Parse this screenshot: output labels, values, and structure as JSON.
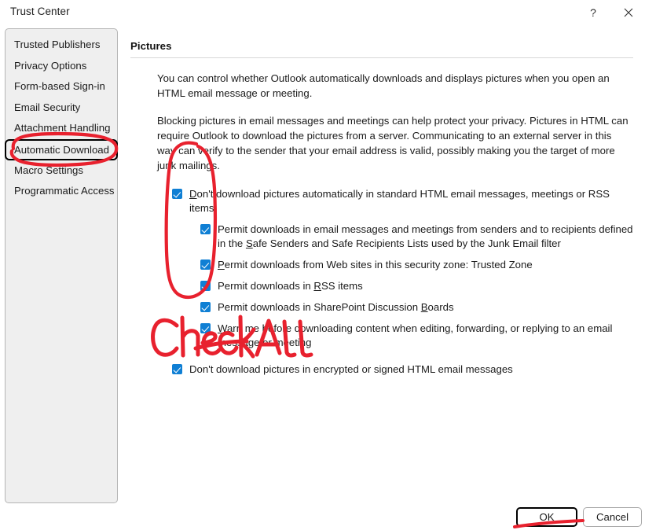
{
  "window": {
    "title": "Trust Center",
    "help_icon": "question-mark-icon",
    "close_icon": "close-x-icon"
  },
  "sidebar": {
    "items": [
      {
        "label": "Trusted Publishers",
        "selected": false
      },
      {
        "label": "Privacy Options",
        "selected": false
      },
      {
        "label": "Form-based Sign-in",
        "selected": false
      },
      {
        "label": "Email Security",
        "selected": false
      },
      {
        "label": "Attachment Handling",
        "selected": false
      },
      {
        "label": "Automatic Download",
        "selected": true
      },
      {
        "label": "Macro Settings",
        "selected": false
      },
      {
        "label": "Programmatic Access",
        "selected": false
      }
    ]
  },
  "main": {
    "section_title": "Pictures",
    "paragraph1": "You can control whether Outlook automatically downloads and displays pictures when you open an HTML email message or meeting.",
    "paragraph2": "Blocking pictures in email messages and meetings can help protect your privacy. Pictures in HTML can require Outlook to download the pictures from a server. Communicating to an external server in this way can verify to the sender that your email address is valid, possibly making you the target of more junk mailings.",
    "options": [
      {
        "level": 1,
        "checked": true,
        "pre": "",
        "accel": "D",
        "post": "on't download pictures automatically in standard HTML email messages, meetings or RSS items"
      },
      {
        "level": 2,
        "checked": true,
        "pre": "Permit downloads in email messages and meetings from senders and to recipients defined in the ",
        "accel": "S",
        "post": "afe Senders and Safe Recipients Lists used by the Junk Email filter"
      },
      {
        "level": 2,
        "checked": true,
        "pre": "",
        "accel": "P",
        "post": "ermit downloads from Web sites in this security zone: Trusted Zone"
      },
      {
        "level": 2,
        "checked": true,
        "pre": "Permit downloads in ",
        "accel": "R",
        "post": "SS items"
      },
      {
        "level": 2,
        "checked": true,
        "pre": "Permit downloads in SharePoint Discussion ",
        "accel": "B",
        "post": "oards"
      },
      {
        "level": 2,
        "checked": true,
        "pre": "",
        "accel": "W",
        "post": "arn me before downloading content when editing, forwarding, or replying to an email message or meeting"
      },
      {
        "level": 1,
        "checked": true,
        "pre": "Don't download pictures in encrypted or signed HTML email messages",
        "accel": "",
        "post": ""
      }
    ]
  },
  "footer": {
    "ok_label": "OK",
    "cancel_label": "Cancel"
  },
  "annotations": {
    "color": "#E8212E",
    "handwriting_text": "CheckAll",
    "ellipse_sidebar": "red-ellipse-automatic-download",
    "ellipse_checkboxes": "red-ellipse-checkbox-column",
    "underline_ok": "red-underline-ok-button"
  },
  "colors": {
    "checkbox_blue": "#0f7fd4",
    "sidebar_bg": "#efefef",
    "annotation_red": "#E8212E"
  }
}
